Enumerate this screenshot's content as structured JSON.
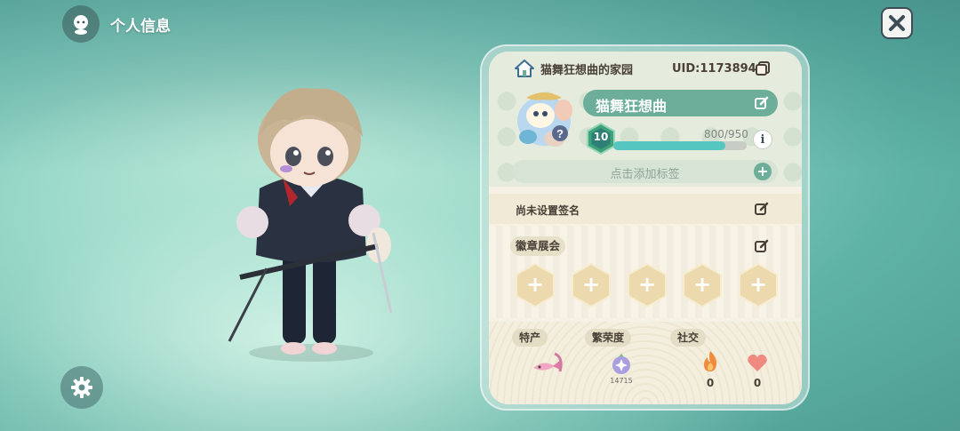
{
  "header": {
    "title": "个人信息"
  },
  "profile": {
    "home_name": "猫舞狂想曲的家园",
    "uid": "UID:1173894",
    "player_name": "猫舞狂想曲",
    "level": "10",
    "exp_text": "800/950",
    "exp_fraction": 0.842,
    "tag_placeholder": "点击添加标签",
    "signature": "尚未设置签名"
  },
  "badges": {
    "title": "徽章展会",
    "slots": [
      "+",
      "+",
      "+",
      "+",
      "+"
    ]
  },
  "stats": {
    "specialty_label": "特产",
    "prosperity_label": "繁荣度",
    "prosperity_value": "14715",
    "social_label": "社交",
    "fire_value": "0",
    "heart_value": "0"
  },
  "icons": {
    "avatar": "head-icon",
    "close": "close-icon",
    "settings": "gear-icon",
    "home": "house-icon",
    "copy": "copy-icon",
    "edit": "pencil-icon",
    "info": "info-icon",
    "fire": "fire-icon",
    "heart": "heart-icon"
  },
  "colors": {
    "accent": "#6cae99",
    "exp_fill": "#56c6c0",
    "panel": "#f5f1e4"
  }
}
